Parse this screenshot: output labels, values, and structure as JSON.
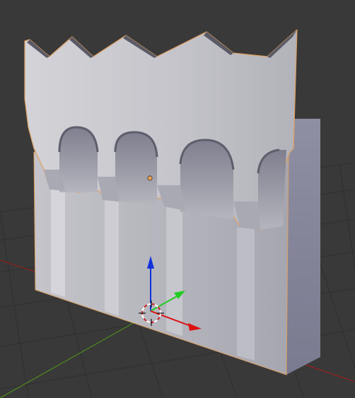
{
  "viewport": {
    "background_color": "#393939",
    "grid_color": "#2e2e2e",
    "selected_outline_color": "#f0a050"
  },
  "axes": {
    "x_axis_color": "#b02222",
    "y_axis_color": "#5a9a22"
  },
  "gizmo": {
    "x_handle_color": "#dd1111",
    "y_handle_color": "#22cc22",
    "z_handle_color": "#1133dd"
  },
  "cursor_3d": {
    "icon": "3d-cursor-icon",
    "ring_colors": [
      "#ffffff",
      "#cc2222"
    ]
  },
  "object": {
    "name_icon": "castle-wall-mesh",
    "origin_color": "#f0a050",
    "shading": "solid"
  }
}
